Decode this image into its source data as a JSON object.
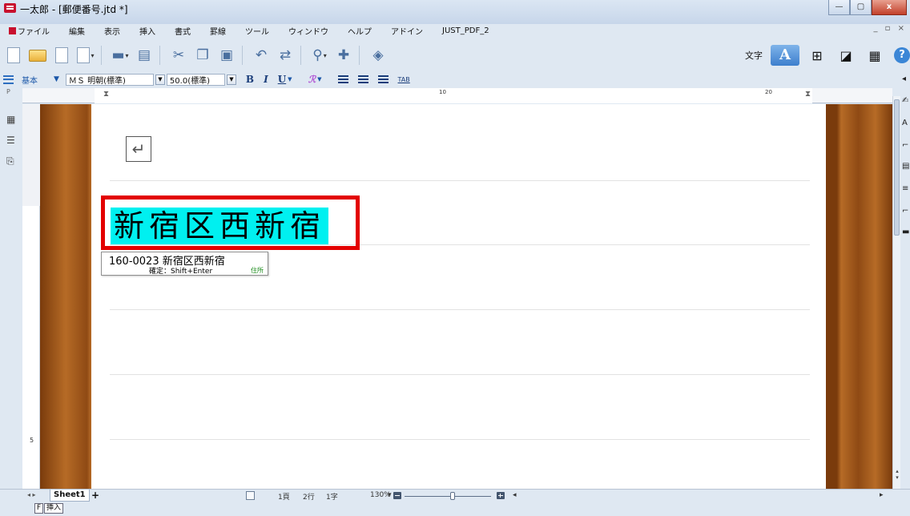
{
  "window": {
    "title": "一太郎 - [郵便番号.jtd *]",
    "buttons": [
      "—",
      "▢",
      "x"
    ]
  },
  "menu": {
    "items": [
      "ファイル",
      "編集",
      "表示",
      "挿入",
      "書式",
      "罫線",
      "ツール",
      "ウィンドウ",
      "ヘルプ",
      "アドイン",
      "JUST_PDF_2"
    ],
    "right": "_ ▫ ×"
  },
  "toolbar": {
    "moji_label": "文字",
    "a_label": "A",
    "help_label": "?"
  },
  "format_bar": {
    "style_name": "基本",
    "font_name": "ＭＳ 明朝(標準)",
    "font_size": "50.0(標準)",
    "bold": "B",
    "italic": "I",
    "underline": "U",
    "tab_label": "TAB"
  },
  "ruler": {
    "marks": [
      "10",
      "20"
    ],
    "left_label": "P"
  },
  "vertical_ruler": {
    "marks": [
      "5"
    ]
  },
  "document": {
    "selected_text": "新宿区西新宿",
    "highlight_color": "#00f0f0",
    "frame_color": "#e30000",
    "return_mark": "↵"
  },
  "conversion_popup": {
    "candidate": "160-0023 新宿区西新宿",
    "hint": "確定：Shift+Enter",
    "type": "住所"
  },
  "status": {
    "sheet_name": "Sheet1",
    "add_sheet": "+",
    "page": "1頁",
    "line": "2行",
    "char": "1字",
    "zoom": "130%",
    "zoom_level_fraction": 0.56
  },
  "mode": {
    "key": "F",
    "label": "挿入"
  }
}
